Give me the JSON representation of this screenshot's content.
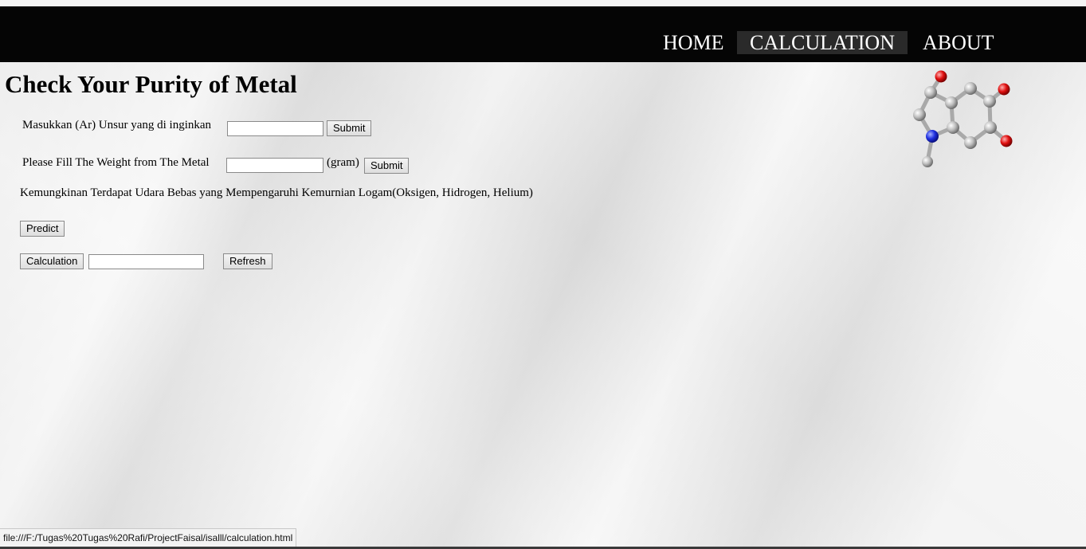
{
  "nav": {
    "home": "HOME",
    "calculation": "CALCULATION",
    "about": "ABOUT"
  },
  "page": {
    "title": "Check Your Purity of Metal"
  },
  "form": {
    "ar_label": "Masukkan (Ar) Unsur yang di inginkan",
    "ar_value": "",
    "ar_submit": "Submit",
    "weight_label": "Please Fill The Weight from The Metal",
    "weight_value": "",
    "weight_unit": "(gram)",
    "weight_submit": "Submit",
    "info_text": "Kemungkinan Terdapat Udara Bebas yang Mempengaruhi Kemurnian Logam(Oksigen, Hidrogen, Helium)",
    "predict_button": "Predict",
    "calculation_button": "Calculation",
    "calculation_value": "",
    "refresh_button": "Refresh"
  },
  "status_bar": {
    "url": "file:///F:/Tugas%20Tugas%20Rafi/ProjectFaisal/isalll/calculation.html"
  },
  "colors": {
    "navbar": "#050505",
    "nav_active": "#2a2a2a",
    "nav_text": "#ffffff"
  },
  "icons": {
    "molecule": "molecule-model-icon"
  }
}
